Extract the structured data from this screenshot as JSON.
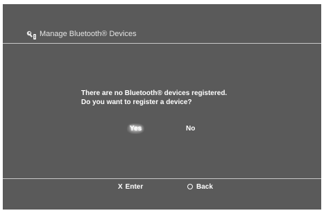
{
  "header": {
    "icon": "bluetooth-settings-icon",
    "title": "Manage Bluetooth® Devices"
  },
  "dialog": {
    "message_line1": "There are no Bluetooth® devices registered.",
    "message_line2": "Do you want to register a device?",
    "options": [
      {
        "label": "Yes",
        "selected": true
      },
      {
        "label": "No",
        "selected": false
      }
    ]
  },
  "footer": {
    "enter": {
      "glyph": "X",
      "label": "Enter",
      "icon": "cross-button-icon"
    },
    "back": {
      "label": "Back",
      "icon": "circle-button-icon"
    }
  },
  "colors": {
    "background": "#5a5a5a",
    "divider": "#c8c8c8",
    "text": "#ffffff"
  }
}
